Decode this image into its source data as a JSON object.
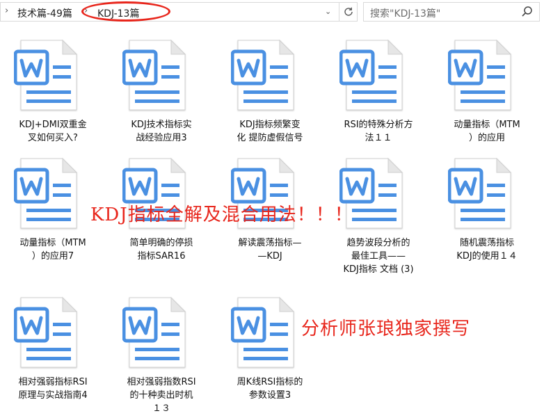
{
  "address_bar": {
    "chevron": "›",
    "crumbs": [
      "技术篇-49篇",
      "KDJ-13篇"
    ],
    "separator": "›",
    "dropdown": "⌄"
  },
  "search": {
    "placeholder": "搜索\"KDJ-13篇\""
  },
  "icon_name": "word-document-icon",
  "colors": {
    "accent": "#4a90e2",
    "overlay": "#e8261c"
  },
  "files": [
    [
      "KDJ+DMI双重金",
      "叉如何买入?"
    ],
    [
      "KDJ技术指标实",
      "战经验应用3"
    ],
    [
      "KDJ指标频繁变",
      "化 提防虚假信号"
    ],
    [
      "RSI的特殊分析方",
      "法１１"
    ],
    [
      "动量指标（MTM",
      "）的应用"
    ],
    [
      "动量指标（MTM",
      "）的应用7"
    ],
    [
      "简单明确的停损",
      "指标SAR16"
    ],
    [
      "解读震荡指标—",
      "—KDJ"
    ],
    [
      "趋势波段分析的",
      "最佳工具——",
      "KDJ指标 文档 (3)"
    ],
    [
      "随机震荡指标",
      "KDJ的使用１４"
    ],
    [
      "相对强弱指标RSI",
      "原理与实战指南4"
    ],
    [
      "相对强弱指数RSI",
      "的十种卖出时机",
      "１３"
    ],
    [
      "周K线RSI指标的",
      "参数设置3"
    ]
  ],
  "overlays": {
    "title": "KDJ指标全解及混合用法！！！",
    "author": "分析师张琅独家撰写"
  }
}
